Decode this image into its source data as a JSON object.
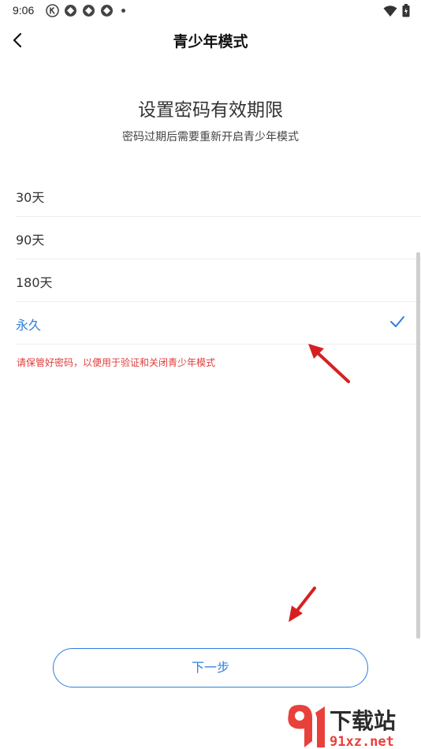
{
  "status_bar": {
    "time": "9:06"
  },
  "app_bar": {
    "title": "青少年模式"
  },
  "heading": "设置密码有效期限",
  "subheading": "密码过期后需要重新开启青少年模式",
  "options": [
    {
      "label": "30天",
      "selected": false
    },
    {
      "label": "90天",
      "selected": false
    },
    {
      "label": "180天",
      "selected": false
    },
    {
      "label": "永久",
      "selected": true
    }
  ],
  "warning": "请保管好密码，以便用于验证和关闭青少年模式",
  "next_button": "下一步",
  "watermark": {
    "brand": "下载站",
    "domain": "91xz.net"
  },
  "colors": {
    "accent": "#2d7fe0",
    "warning": "#e23b3b",
    "annotation": "#d62020"
  }
}
